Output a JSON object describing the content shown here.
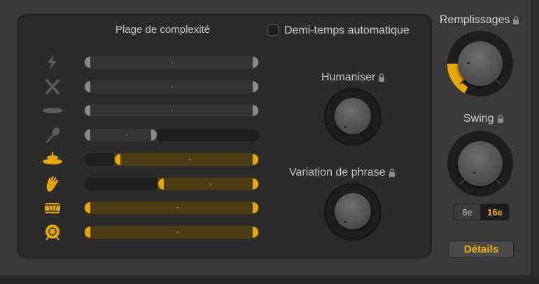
{
  "panel": {
    "complexity_title": "Plage de complexité",
    "half_time_label": "Demi-temps automatique",
    "half_time_checked": false
  },
  "knobs": {
    "humanize": "Humaniser",
    "phrase": "Variation de phrase",
    "fills": "Remplissages",
    "swing": "Swing"
  },
  "swing_resolution": {
    "options": [
      "8e",
      "16e"
    ],
    "selected": "16e"
  },
  "details_button": "Détails",
  "instruments": [
    {
      "icon": "lightning-icon",
      "active": false,
      "range": [
        0,
        1
      ],
      "value": 0.5
    },
    {
      "icon": "crossed-sticks-icon",
      "active": false,
      "range": [
        0,
        1
      ],
      "value": 0.5
    },
    {
      "icon": "cymbal-icon",
      "active": false,
      "range": [
        0,
        1
      ],
      "value": 0.5
    },
    {
      "icon": "shaker-icon",
      "active": false,
      "range": [
        0,
        0.42
      ],
      "value": 0.24
    },
    {
      "icon": "hihat-icon",
      "active": true,
      "range": [
        0.17,
        1
      ],
      "value": 0.6
    },
    {
      "icon": "hand-clap-icon",
      "active": true,
      "range": [
        0.42,
        1
      ],
      "value": 0.72
    },
    {
      "icon": "snare-drum-icon",
      "active": true,
      "range": [
        0,
        1
      ],
      "value": 0.53
    },
    {
      "icon": "kick-drum-icon",
      "active": true,
      "range": [
        0,
        1
      ],
      "value": 0.53
    }
  ],
  "colors": {
    "accent": "#e6a800",
    "inactive": "#8a8a8a",
    "panel": "#2b2b2b"
  }
}
